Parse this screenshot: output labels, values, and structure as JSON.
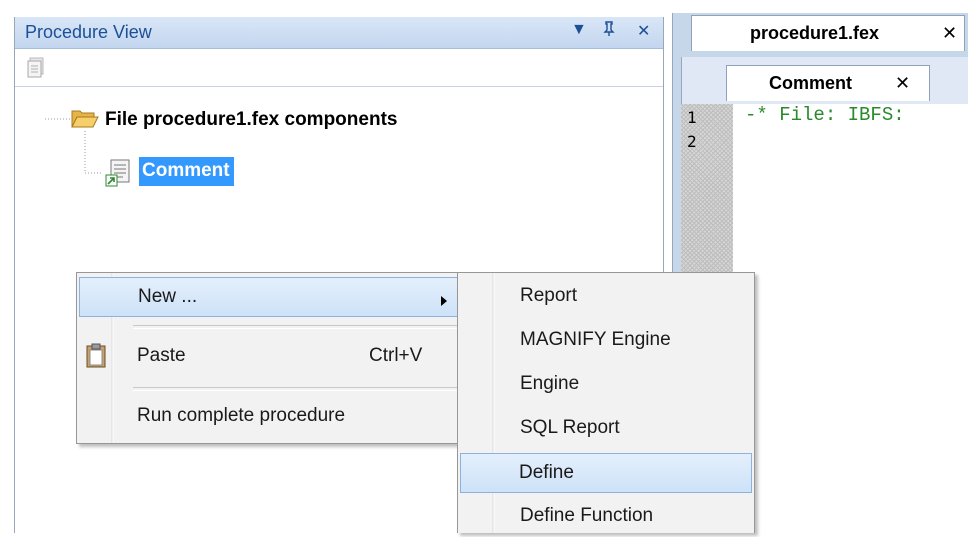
{
  "procedure_view": {
    "title": "Procedure View",
    "controls": {
      "dropdown": "▼",
      "pin": "⎕",
      "close": "✕"
    },
    "toolbar": {
      "icon": "document-icon"
    }
  },
  "tree": {
    "root_label": "File procedure1.fex components",
    "root_icon": "folder-open-icon",
    "child_label": "Comment",
    "child_icon": "comment-doc-icon",
    "selection_color": "#3399ff"
  },
  "editor": {
    "file_tab": {
      "label": "procedure1.fex",
      "close": "✕"
    },
    "comment_tab": {
      "label": "Comment",
      "close": "✕"
    },
    "line_numbers": [
      "1",
      "2"
    ],
    "code_line_1": "-* File: IBFS:"
  },
  "context_menu": {
    "items": [
      {
        "label": "New ...",
        "has_submenu": true
      },
      {
        "label": "Paste",
        "shortcut": "Ctrl+V",
        "icon": "clipboard-icon"
      },
      {
        "label": "Run complete procedure"
      }
    ]
  },
  "submenu": {
    "items": [
      "Report",
      "MAGNIFY Engine",
      "Engine",
      "SQL Report",
      "Define",
      "Define Function"
    ],
    "highlighted": "Define"
  }
}
